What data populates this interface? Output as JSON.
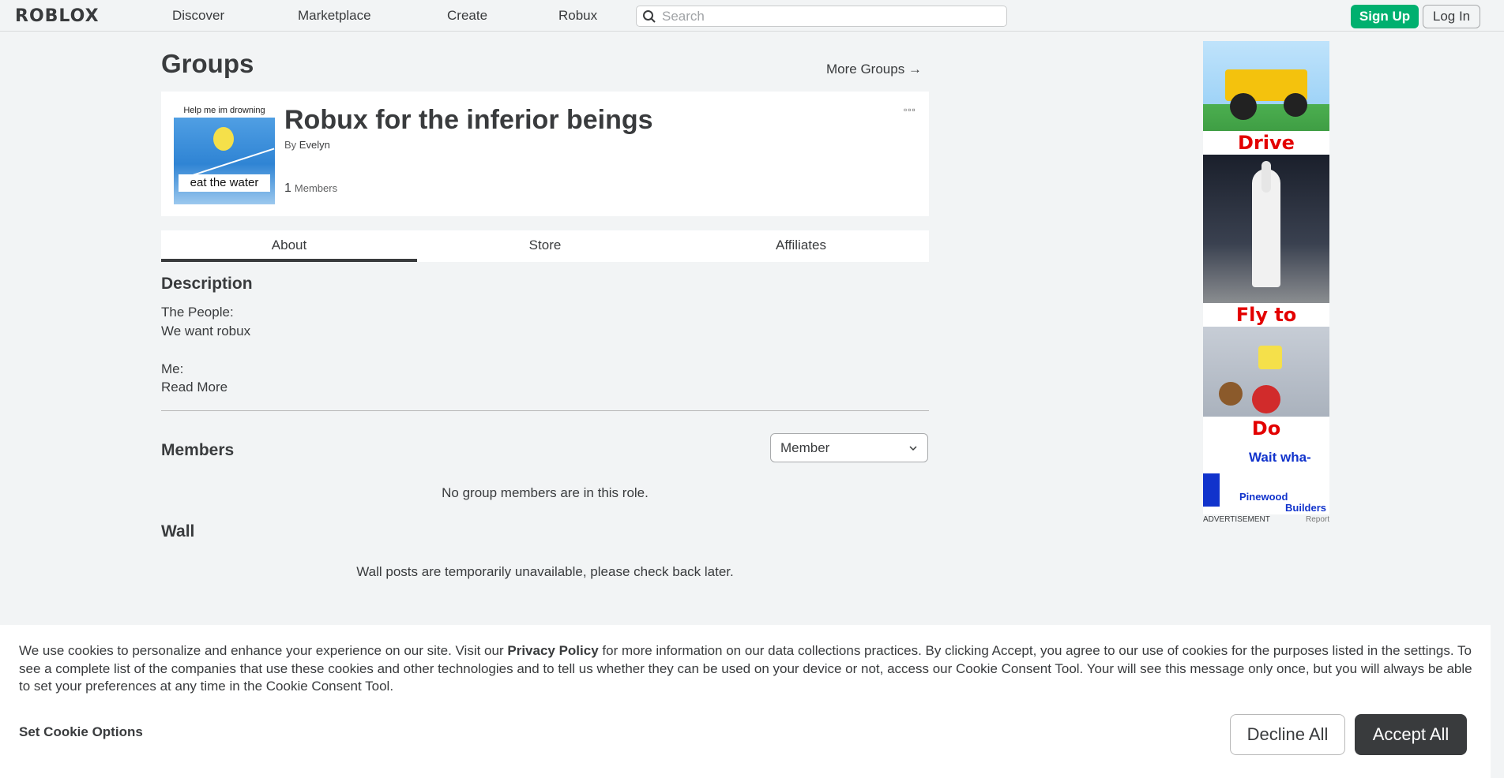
{
  "nav": {
    "logo": "ROBLOX",
    "links": [
      "Discover",
      "Marketplace",
      "Create",
      "Robux"
    ],
    "search_placeholder": "Search",
    "signup_label": "Sign Up",
    "login_label": "Log In"
  },
  "page": {
    "title": "Groups",
    "more_groups": "More Groups →"
  },
  "group": {
    "name": "Robux for the inferior beings",
    "by_label": "By",
    "owner": "Evelyn",
    "member_count": "1",
    "members_label": "Members",
    "menu": "▫▫▫",
    "thumb_caption_top": "Help me im drowning",
    "thumb_caption_bottom": "eat the water"
  },
  "tabs": [
    "About",
    "Store",
    "Affiliates"
  ],
  "about": {
    "description_heading": "Description",
    "description_lines": [
      "The People:",
      "We want robux",
      "",
      "Me:"
    ],
    "read_more": "Read More",
    "members_heading": "Members",
    "role_selected": "Member",
    "members_empty": "No group members are in this role.",
    "wall_heading": "Wall",
    "wall_message": "Wall posts are temporarily unavailable, please check back later."
  },
  "ad": {
    "captions": [
      "Drive beasts!",
      "Fly to space!",
      "Do laundry!!"
    ],
    "tagline": "Wait wha-",
    "brand_line1": "Pinewood",
    "brand_line2": "Builders",
    "footer_label": "ADVERTISEMENT",
    "report_label": "Report"
  },
  "cookie": {
    "text_before": "We use cookies to personalize and enhance your experience on our site. Visit our ",
    "privacy_link": "Privacy Policy",
    "text_after": " for more information on our data collections practices. By clicking Accept, you agree to our use of cookies for the purposes listed in the settings. To see a complete list of the companies that use these cookies and other technologies and to tell us whether they can be used on your device or not, access our Cookie Consent Tool. Your will see this message only once, but you will always be able to set your preferences at any time in the Cookie Consent Tool.",
    "set_options": "Set Cookie Options",
    "decline": "Decline All",
    "accept": "Accept All"
  },
  "colors": {
    "accent_green": "#00b06f",
    "text_dark": "#393b3d",
    "page_bg": "#f2f4f5",
    "ad_red": "#e30000"
  }
}
